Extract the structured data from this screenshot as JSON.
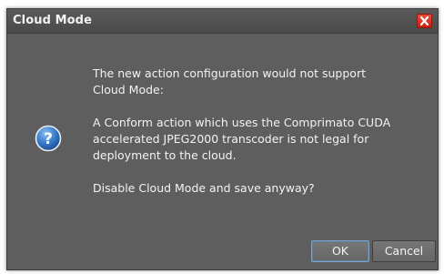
{
  "dialog": {
    "title": "Cloud Mode",
    "close_icon": "close-icon",
    "icon": "question-icon",
    "message": {
      "line1": "The new action configuration would not support",
      "line2": "Cloud Mode:",
      "line3": "A Conform action which uses the Comprimato CUDA",
      "line4": "accelerated JPEG2000 transcoder is not legal for",
      "line5": "deployment to the cloud.",
      "line6": "Disable Cloud Mode and save anyway?"
    },
    "buttons": {
      "ok_label": "OK",
      "cancel_label": "Cancel"
    }
  },
  "colors": {
    "dialog_bg": "#5e5e5e",
    "close_button": "#e0352a",
    "icon_blue": "#2f6fc0"
  }
}
